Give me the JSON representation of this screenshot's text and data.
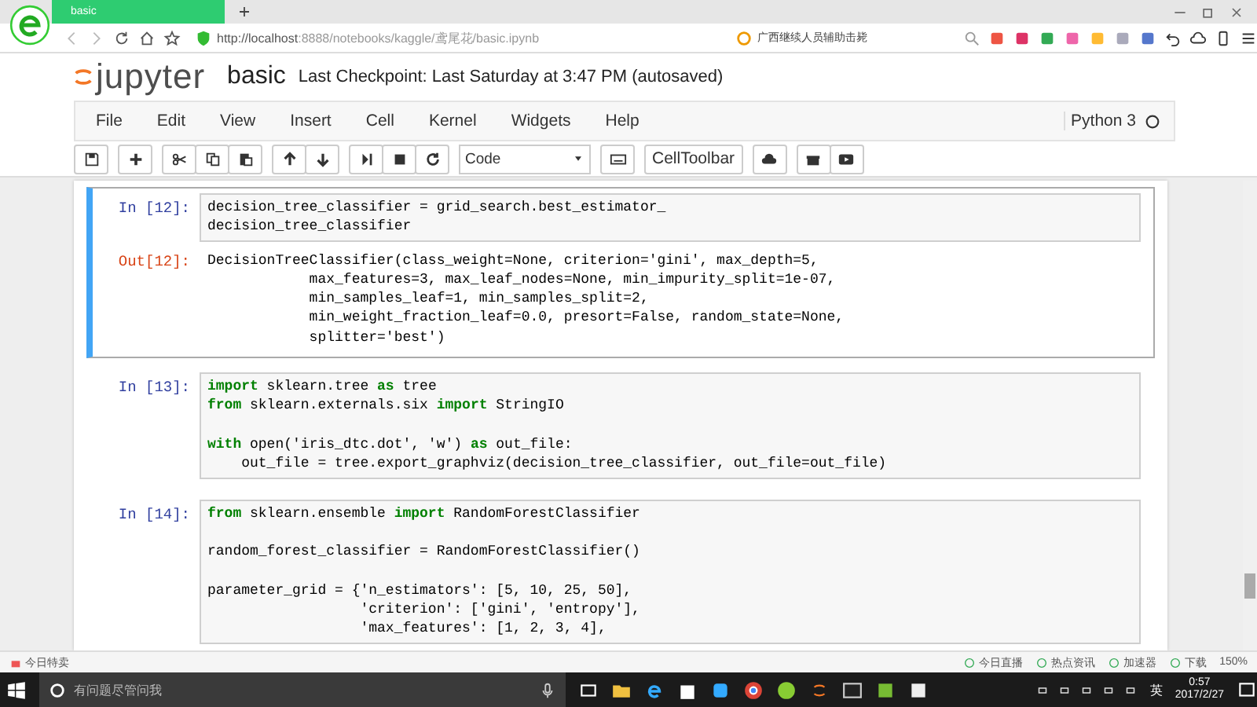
{
  "browser": {
    "tab_title": "basic",
    "url_host": "http://localhost",
    "url_rest": ":8888/notebooks/kaggle/鸢尾花/basic.ipynb",
    "search_text": "广西继续人员辅助击毙"
  },
  "notebook": {
    "logo_text": "jupyter",
    "title": "basic",
    "checkpoint": "Last Checkpoint: Last Saturday at 3:47 PM (autosaved)",
    "kernel": "Python 3",
    "menu": [
      "File",
      "Edit",
      "View",
      "Insert",
      "Cell",
      "Kernel",
      "Widgets",
      "Help"
    ],
    "cell_type": "Code",
    "celltoolbar": "CellToolbar"
  },
  "cells": [
    {
      "selected": true,
      "prompt": "In [12]:",
      "blocks": [
        [
          "decision_tree_classifier = grid_search.best_estimator_",
          "decision_tree_classifier"
        ]
      ],
      "output": {
        "prompt": "Out[12]:",
        "lines": [
          "DecisionTreeClassifier(class_weight=None, criterion='gini', max_depth=5,",
          "            max_features=3, max_leaf_nodes=None, min_impurity_split=1e-07,",
          "            min_samples_leaf=1, min_samples_split=2,",
          "            min_weight_fraction_leaf=0.0, presort=False, random_state=None,",
          "            splitter='best')"
        ]
      }
    },
    {
      "selected": false,
      "prompt": "In [13]:",
      "blocks": [
        [
          "**import** sklearn.tree **as** tree",
          "**from** sklearn.externals.six **import** StringIO"
        ],
        [
          "**with** open('iris_dtc.dot', 'w') **as** out_file:",
          "    out_file = tree.export_graphviz(decision_tree_classifier, out_file=out_file)"
        ]
      ]
    },
    {
      "selected": false,
      "prompt": "In [14]:",
      "blocks": [
        [
          "**from** sklearn.ensemble **import** RandomForestClassifier"
        ],
        [
          "random_forest_classifier = RandomForestClassifier()"
        ],
        [
          "parameter_grid = {'n_estimators': [5, 10, 25, 50],",
          "                  'criterion': ['gini', 'entropy'],",
          "                  'max_features': [1, 2, 3, 4],"
        ]
      ]
    }
  ],
  "status_bar": {
    "left": "今日特卖",
    "items": [
      "今日直播",
      "热点资讯",
      "加速器",
      "下载"
    ],
    "zoom": "150%"
  },
  "taskbar": {
    "search_placeholder": "有问题尽管问我",
    "ime": "英",
    "time": "0:57",
    "date": "2017/2/27"
  }
}
